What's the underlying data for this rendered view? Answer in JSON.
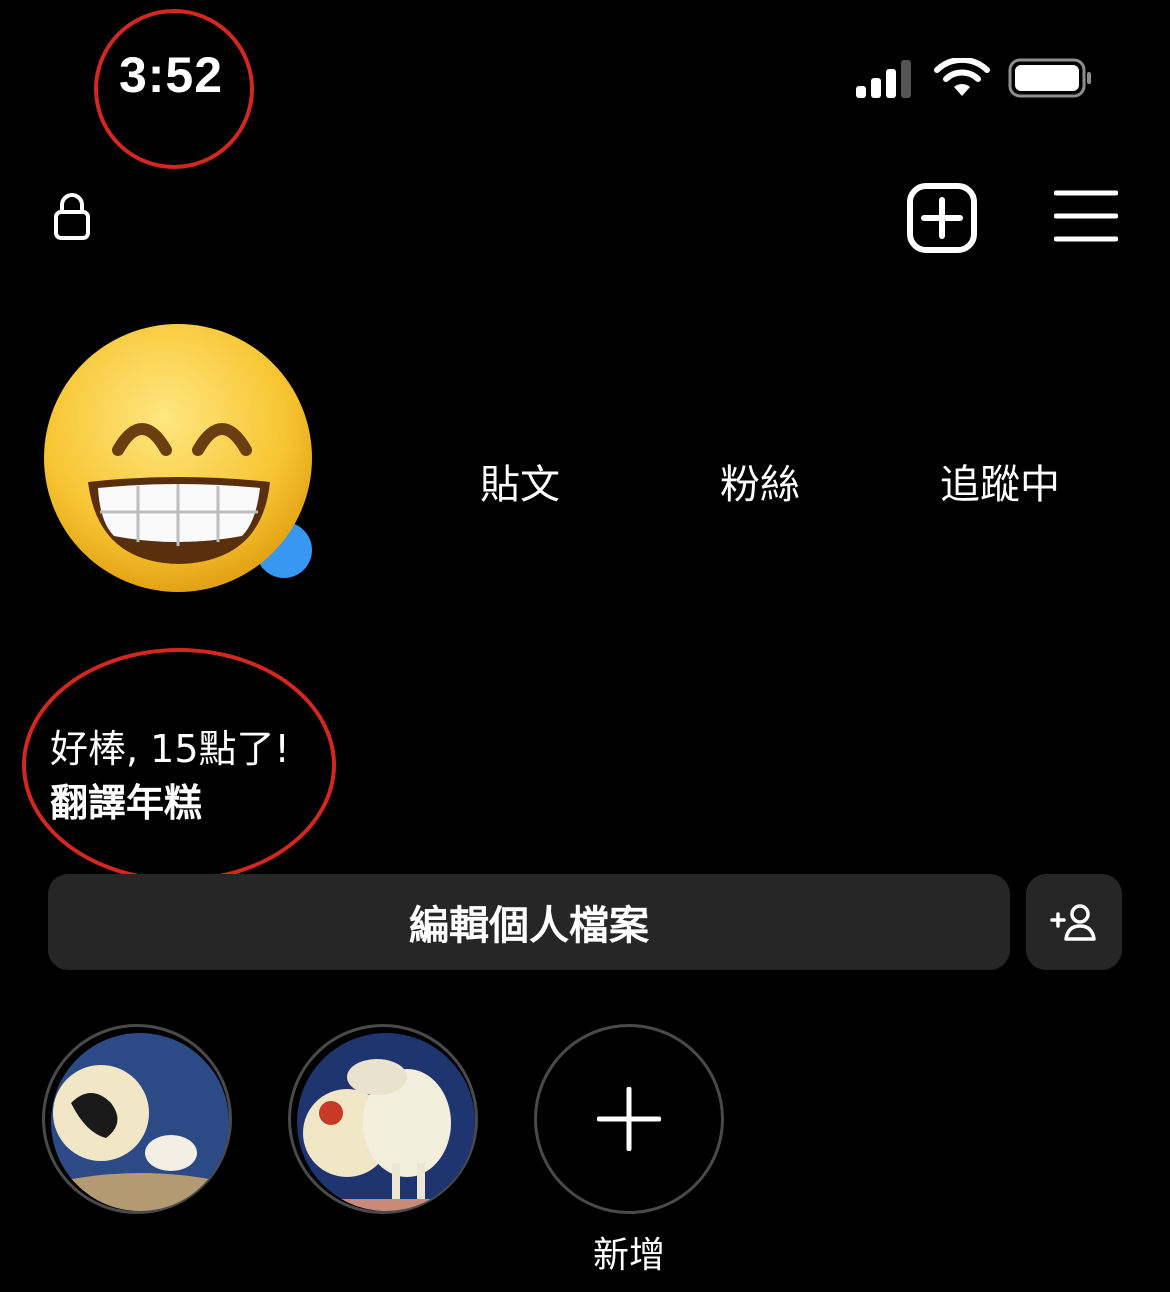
{
  "status_bar": {
    "time": "3:52",
    "signal_icon": "cellular-signal-icon",
    "wifi_icon": "wifi-icon",
    "battery_icon": "battery-icon"
  },
  "top_bar": {
    "lock_icon": "lock-icon",
    "new_post_icon": "plus-square-icon",
    "menu_icon": "hamburger-menu-icon"
  },
  "profile": {
    "avatar": "grinning-face-emoji",
    "stats": {
      "posts_label": "貼文",
      "followers_label": "粉絲",
      "following_label": "追蹤中"
    },
    "bio": {
      "line1": "好棒, 15點了!",
      "line2": "翻譯年糕"
    }
  },
  "actions": {
    "edit_profile_label": "編輯個人檔案",
    "add_friend_icon": "add-person-icon"
  },
  "highlights": {
    "new_label": "新增"
  },
  "colors": {
    "background": "#000000",
    "button_bg": "#262626",
    "annotation_red": "#d2281f",
    "badge_blue": "#3897f0"
  }
}
